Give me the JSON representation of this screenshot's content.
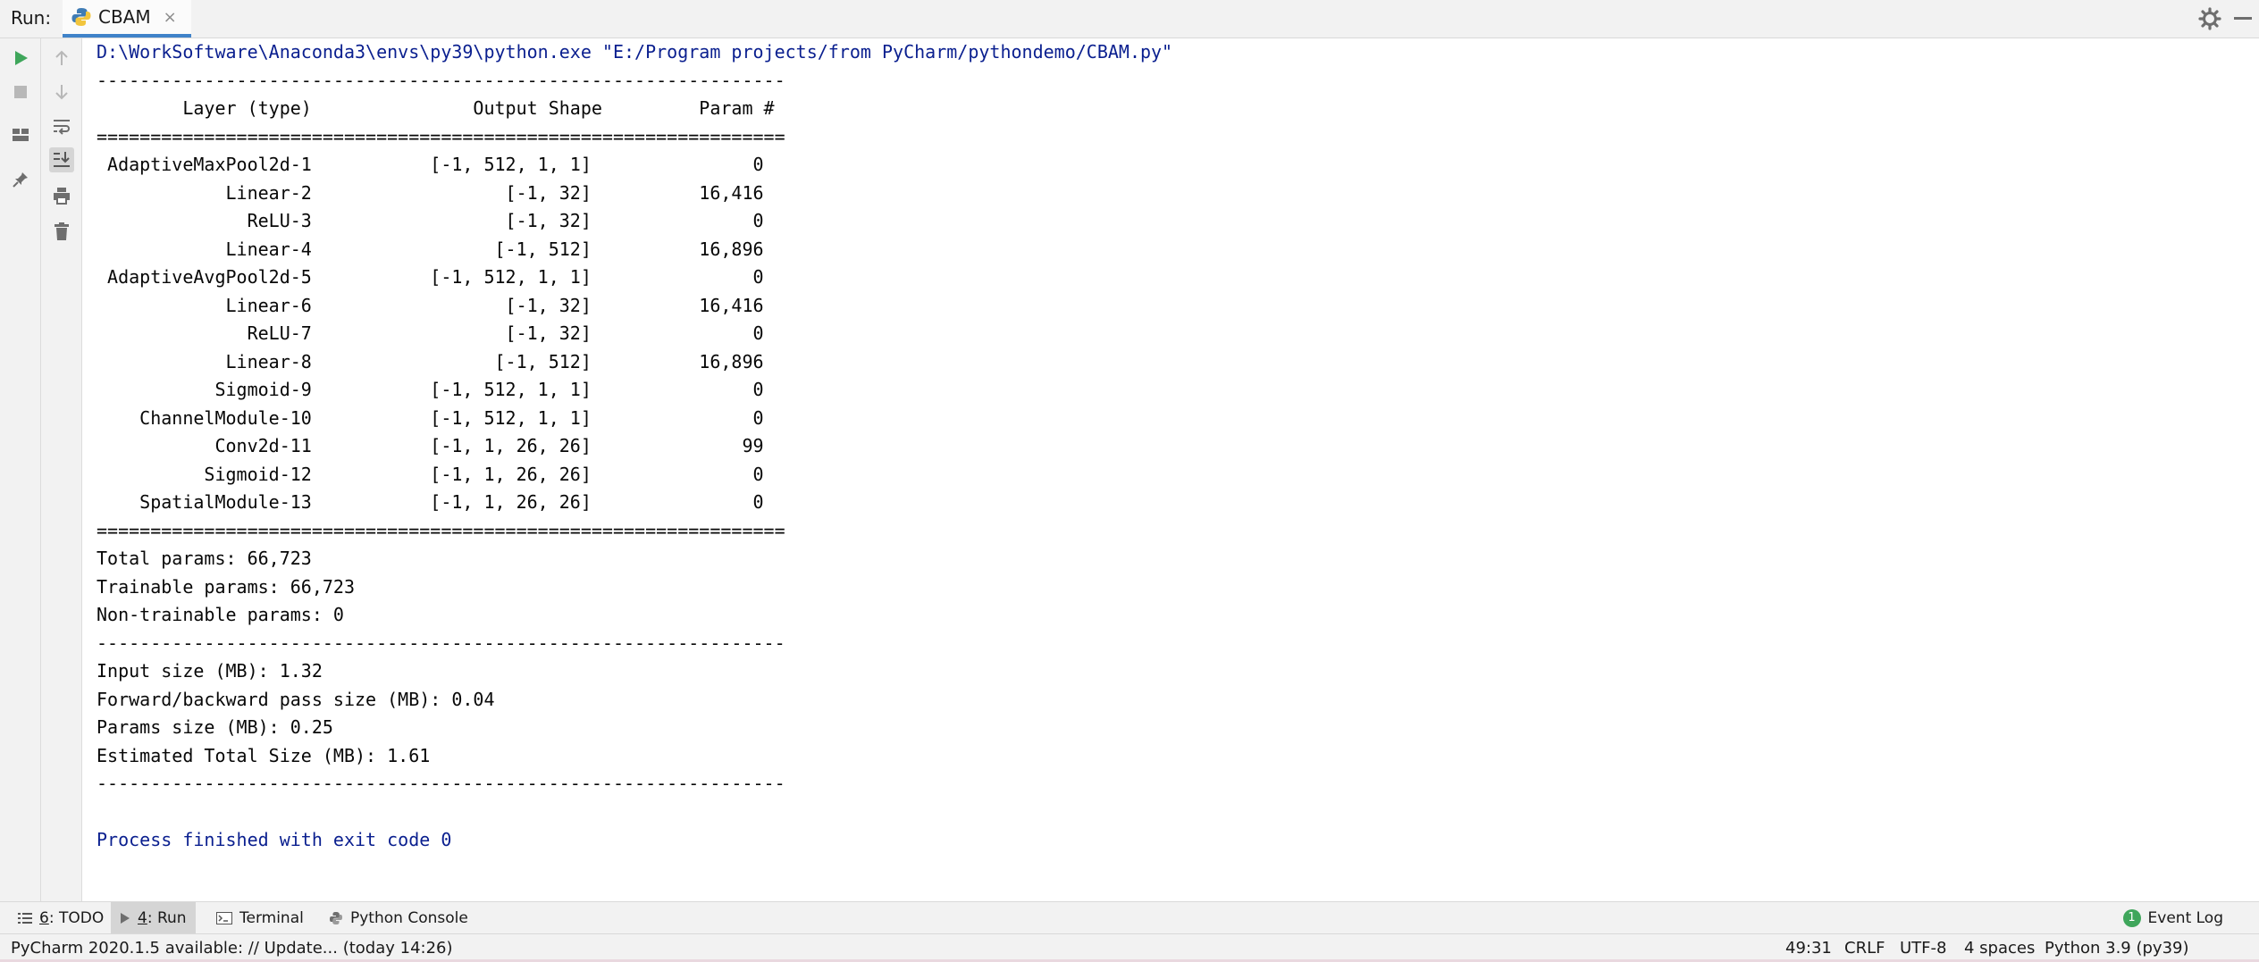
{
  "run_bar": {
    "label": "Run:",
    "tab_title": "CBAM",
    "tab_close": "×"
  },
  "console": {
    "lines": [
      {
        "text": "D:\\WorkSoftware\\Anaconda3\\envs\\py39\\python.exe \"E:/Program projects/from PyCharm/pythondemo/CBAM.py\"",
        "kind": "sys"
      },
      {
        "text": "----------------------------------------------------------------",
        "kind": "out"
      },
      {
        "text": "        Layer (type)               Output Shape         Param #",
        "kind": "out"
      },
      {
        "text": "================================================================",
        "kind": "out"
      },
      {
        "text": " AdaptiveMaxPool2d-1           [-1, 512, 1, 1]               0",
        "kind": "out"
      },
      {
        "text": "            Linear-2                  [-1, 32]          16,416",
        "kind": "out"
      },
      {
        "text": "              ReLU-3                  [-1, 32]               0",
        "kind": "out"
      },
      {
        "text": "            Linear-4                 [-1, 512]          16,896",
        "kind": "out"
      },
      {
        "text": " AdaptiveAvgPool2d-5           [-1, 512, 1, 1]               0",
        "kind": "out"
      },
      {
        "text": "            Linear-6                  [-1, 32]          16,416",
        "kind": "out"
      },
      {
        "text": "              ReLU-7                  [-1, 32]               0",
        "kind": "out"
      },
      {
        "text": "            Linear-8                 [-1, 512]          16,896",
        "kind": "out"
      },
      {
        "text": "           Sigmoid-9           [-1, 512, 1, 1]               0",
        "kind": "out"
      },
      {
        "text": "    ChannelModule-10           [-1, 512, 1, 1]               0",
        "kind": "out"
      },
      {
        "text": "           Conv2d-11           [-1, 1, 26, 26]              99",
        "kind": "out"
      },
      {
        "text": "          Sigmoid-12           [-1, 1, 26, 26]               0",
        "kind": "out"
      },
      {
        "text": "    SpatialModule-13           [-1, 1, 26, 26]               0",
        "kind": "out"
      },
      {
        "text": "================================================================",
        "kind": "out"
      },
      {
        "text": "Total params: 66,723",
        "kind": "out"
      },
      {
        "text": "Trainable params: 66,723",
        "kind": "out"
      },
      {
        "text": "Non-trainable params: 0",
        "kind": "out"
      },
      {
        "text": "----------------------------------------------------------------",
        "kind": "out"
      },
      {
        "text": "Input size (MB): 1.32",
        "kind": "out"
      },
      {
        "text": "Forward/backward pass size (MB): 0.04",
        "kind": "out"
      },
      {
        "text": "Params size (MB): 0.25",
        "kind": "out"
      },
      {
        "text": "Estimated Total Size (MB): 1.61",
        "kind": "out"
      },
      {
        "text": "----------------------------------------------------------------",
        "kind": "out"
      },
      {
        "text": "",
        "kind": "out"
      },
      {
        "text": "Process finished with exit code 0",
        "kind": "sys"
      }
    ]
  },
  "tool_windows": {
    "todo_key": "6",
    "todo_label": ": TODO",
    "run_key": "4",
    "run_label": ": Run",
    "terminal": "Terminal",
    "python_console": "Python Console",
    "event_log": "Event Log",
    "event_count": "1"
  },
  "status_bar": {
    "message": "PyCharm 2020.1.5 available: // Update... (today 14:26)",
    "position": "49:31",
    "line_sep": "CRLF",
    "encoding": "UTF-8",
    "indent": "4 spaces",
    "interpreter": "Python 3.9 (py39)"
  },
  "icons": {
    "run": "run-icon",
    "stop": "stop-icon",
    "layout": "layout-icon",
    "pin": "pin-icon",
    "up": "arrow-up-icon",
    "down": "arrow-down-icon",
    "wrap": "soft-wrap-icon",
    "scroll": "scroll-to-end-icon",
    "print": "print-icon",
    "trash": "trash-icon",
    "settings": "gear-icon"
  },
  "colors": {
    "accent": "#4083c9",
    "run_green": "#3fa65b",
    "console_system": "#0a1f8f"
  }
}
